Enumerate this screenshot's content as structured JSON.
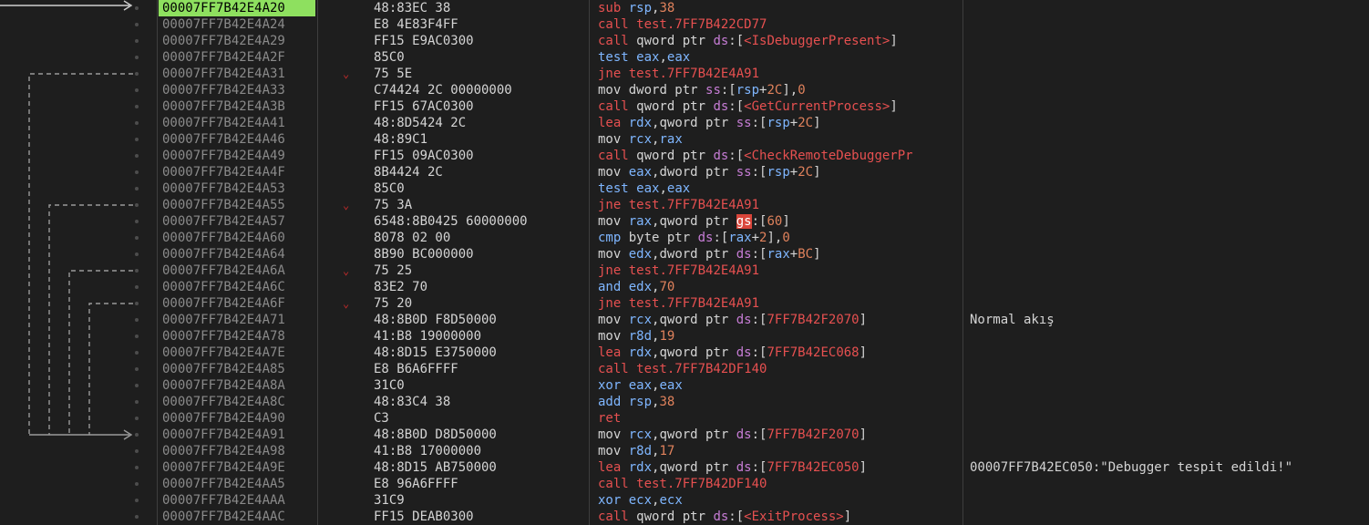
{
  "rows": [
    {
      "addr": "00007FF7B42E4A20",
      "bytes": "48:83EC 38",
      "instr": [
        {
          "t": "sub",
          "c": "mn"
        },
        {
          "t": " ",
          "c": "txt"
        },
        {
          "t": "rsp",
          "c": "reg"
        },
        {
          "t": ",",
          "c": "txt"
        },
        {
          "t": "38",
          "c": "num"
        }
      ],
      "selected": true
    },
    {
      "addr": "00007FF7B42E4A24",
      "bytes": "E8 4E83F4FF",
      "instr": [
        {
          "t": "call",
          "c": "mn"
        },
        {
          "t": " test.7FF7B422CD77",
          "c": "sym"
        }
      ]
    },
    {
      "addr": "00007FF7B42E4A29",
      "bytes": "FF15 E9AC0300",
      "instr": [
        {
          "t": "call",
          "c": "mn"
        },
        {
          "t": " qword ptr ",
          "c": "kw"
        },
        {
          "t": "ds",
          "c": "seg"
        },
        {
          "t": ":[",
          "c": "txt"
        },
        {
          "t": "<IsDebuggerPresent>",
          "c": "sym"
        },
        {
          "t": "]",
          "c": "txt"
        }
      ]
    },
    {
      "addr": "00007FF7B42E4A2F",
      "bytes": "85C0",
      "instr": [
        {
          "t": "test",
          "c": "reg"
        },
        {
          "t": " ",
          "c": "txt"
        },
        {
          "t": "eax",
          "c": "reg"
        },
        {
          "t": ",",
          "c": "txt"
        },
        {
          "t": "eax",
          "c": "reg"
        }
      ]
    },
    {
      "addr": "00007FF7B42E4A31",
      "bytes": "75 5E",
      "arrow": "⌄",
      "instr": [
        {
          "t": "jne",
          "c": "mn"
        },
        {
          "t": " test.7FF7B42E4A91",
          "c": "sym"
        }
      ]
    },
    {
      "addr": "00007FF7B42E4A33",
      "bytes": "C74424 2C 00000000",
      "instr": [
        {
          "t": "mov",
          "c": "txt"
        },
        {
          "t": " dword ptr ",
          "c": "kw"
        },
        {
          "t": "ss",
          "c": "seg"
        },
        {
          "t": ":[",
          "c": "txt"
        },
        {
          "t": "rsp",
          "c": "reg"
        },
        {
          "t": "+",
          "c": "txt"
        },
        {
          "t": "2C",
          "c": "num"
        },
        {
          "t": "],",
          "c": "txt"
        },
        {
          "t": "0",
          "c": "num"
        }
      ]
    },
    {
      "addr": "00007FF7B42E4A3B",
      "bytes": "FF15 67AC0300",
      "instr": [
        {
          "t": "call",
          "c": "mn"
        },
        {
          "t": " qword ptr ",
          "c": "kw"
        },
        {
          "t": "ds",
          "c": "seg"
        },
        {
          "t": ":[",
          "c": "txt"
        },
        {
          "t": "<GetCurrentProcess>",
          "c": "sym"
        },
        {
          "t": "]",
          "c": "txt"
        }
      ]
    },
    {
      "addr": "00007FF7B42E4A41",
      "bytes": "48:8D5424 2C",
      "instr": [
        {
          "t": "lea",
          "c": "mn"
        },
        {
          "t": " ",
          "c": "txt"
        },
        {
          "t": "rdx",
          "c": "reg"
        },
        {
          "t": ",qword ptr ",
          "c": "kw"
        },
        {
          "t": "ss",
          "c": "seg"
        },
        {
          "t": ":[",
          "c": "txt"
        },
        {
          "t": "rsp",
          "c": "reg"
        },
        {
          "t": "+",
          "c": "txt"
        },
        {
          "t": "2C",
          "c": "num"
        },
        {
          "t": "]",
          "c": "txt"
        }
      ]
    },
    {
      "addr": "00007FF7B42E4A46",
      "bytes": "48:89C1",
      "instr": [
        {
          "t": "mov",
          "c": "txt"
        },
        {
          "t": " ",
          "c": "txt"
        },
        {
          "t": "rcx",
          "c": "reg"
        },
        {
          "t": ",",
          "c": "txt"
        },
        {
          "t": "rax",
          "c": "reg"
        }
      ]
    },
    {
      "addr": "00007FF7B42E4A49",
      "bytes": "FF15 09AC0300",
      "instr": [
        {
          "t": "call",
          "c": "mn"
        },
        {
          "t": " qword ptr ",
          "c": "kw"
        },
        {
          "t": "ds",
          "c": "seg"
        },
        {
          "t": ":[",
          "c": "txt"
        },
        {
          "t": "<CheckRemoteDebuggerPr",
          "c": "sym"
        }
      ]
    },
    {
      "addr": "00007FF7B42E4A4F",
      "bytes": "8B4424 2C",
      "instr": [
        {
          "t": "mov",
          "c": "txt"
        },
        {
          "t": " ",
          "c": "txt"
        },
        {
          "t": "eax",
          "c": "reg"
        },
        {
          "t": ",dword ptr ",
          "c": "kw"
        },
        {
          "t": "ss",
          "c": "seg"
        },
        {
          "t": ":[",
          "c": "txt"
        },
        {
          "t": "rsp",
          "c": "reg"
        },
        {
          "t": "+",
          "c": "txt"
        },
        {
          "t": "2C",
          "c": "num"
        },
        {
          "t": "]",
          "c": "txt"
        }
      ]
    },
    {
      "addr": "00007FF7B42E4A53",
      "bytes": "85C0",
      "instr": [
        {
          "t": "test",
          "c": "reg"
        },
        {
          "t": " ",
          "c": "txt"
        },
        {
          "t": "eax",
          "c": "reg"
        },
        {
          "t": ",",
          "c": "txt"
        },
        {
          "t": "eax",
          "c": "reg"
        }
      ]
    },
    {
      "addr": "00007FF7B42E4A55",
      "bytes": "75 3A",
      "arrow": "⌄",
      "instr": [
        {
          "t": "jne",
          "c": "mn"
        },
        {
          "t": " test.7FF7B42E4A91",
          "c": "sym"
        }
      ]
    },
    {
      "addr": "00007FF7B42E4A57",
      "bytes": "6548:8B0425 60000000",
      "instr": [
        {
          "t": "mov",
          "c": "txt"
        },
        {
          "t": " ",
          "c": "txt"
        },
        {
          "t": "rax",
          "c": "reg"
        },
        {
          "t": ",qword ptr ",
          "c": "kw"
        },
        {
          "t": "gs",
          "c": "seghl"
        },
        {
          "t": ":[",
          "c": "txt"
        },
        {
          "t": "60",
          "c": "num"
        },
        {
          "t": "]",
          "c": "txt"
        }
      ]
    },
    {
      "addr": "00007FF7B42E4A60",
      "bytes": "8078 02 00",
      "instr": [
        {
          "t": "cmp",
          "c": "reg"
        },
        {
          "t": " byte ptr ",
          "c": "kw"
        },
        {
          "t": "ds",
          "c": "seg"
        },
        {
          "t": ":[",
          "c": "txt"
        },
        {
          "t": "rax",
          "c": "reg"
        },
        {
          "t": "+",
          "c": "txt"
        },
        {
          "t": "2",
          "c": "num"
        },
        {
          "t": "],",
          "c": "txt"
        },
        {
          "t": "0",
          "c": "num"
        }
      ]
    },
    {
      "addr": "00007FF7B42E4A64",
      "bytes": "8B90 BC000000",
      "instr": [
        {
          "t": "mov",
          "c": "txt"
        },
        {
          "t": " ",
          "c": "txt"
        },
        {
          "t": "edx",
          "c": "reg"
        },
        {
          "t": ",dword ptr ",
          "c": "kw"
        },
        {
          "t": "ds",
          "c": "seg"
        },
        {
          "t": ":[",
          "c": "txt"
        },
        {
          "t": "rax",
          "c": "reg"
        },
        {
          "t": "+",
          "c": "txt"
        },
        {
          "t": "BC",
          "c": "num"
        },
        {
          "t": "]",
          "c": "txt"
        }
      ]
    },
    {
      "addr": "00007FF7B42E4A6A",
      "bytes": "75 25",
      "arrow": "⌄",
      "instr": [
        {
          "t": "jne",
          "c": "mn"
        },
        {
          "t": " test.7FF7B42E4A91",
          "c": "sym"
        }
      ]
    },
    {
      "addr": "00007FF7B42E4A6C",
      "bytes": "83E2 70",
      "instr": [
        {
          "t": "and",
          "c": "reg"
        },
        {
          "t": " ",
          "c": "txt"
        },
        {
          "t": "edx",
          "c": "reg"
        },
        {
          "t": ",",
          "c": "txt"
        },
        {
          "t": "70",
          "c": "num"
        }
      ]
    },
    {
      "addr": "00007FF7B42E4A6F",
      "bytes": "75 20",
      "arrow": "⌄",
      "instr": [
        {
          "t": "jne",
          "c": "mn"
        },
        {
          "t": " test.7FF7B42E4A91",
          "c": "sym"
        }
      ]
    },
    {
      "addr": "00007FF7B42E4A71",
      "bytes": "48:8B0D F8D50000",
      "instr": [
        {
          "t": "mov",
          "c": "txt"
        },
        {
          "t": " ",
          "c": "txt"
        },
        {
          "t": "rcx",
          "c": "reg"
        },
        {
          "t": ",qword ptr ",
          "c": "kw"
        },
        {
          "t": "ds",
          "c": "seg"
        },
        {
          "t": ":[",
          "c": "txt"
        },
        {
          "t": "7FF7B42F2070",
          "c": "sym"
        },
        {
          "t": "]",
          "c": "txt"
        }
      ],
      "comment": "Normal akış"
    },
    {
      "addr": "00007FF7B42E4A78",
      "bytes": "41:B8 19000000",
      "instr": [
        {
          "t": "mov",
          "c": "txt"
        },
        {
          "t": " ",
          "c": "txt"
        },
        {
          "t": "r8d",
          "c": "reg"
        },
        {
          "t": ",",
          "c": "txt"
        },
        {
          "t": "19",
          "c": "num"
        }
      ]
    },
    {
      "addr": "00007FF7B42E4A7E",
      "bytes": "48:8D15 E3750000",
      "instr": [
        {
          "t": "lea",
          "c": "mn"
        },
        {
          "t": " ",
          "c": "txt"
        },
        {
          "t": "rdx",
          "c": "reg"
        },
        {
          "t": ",qword ptr ",
          "c": "kw"
        },
        {
          "t": "ds",
          "c": "seg"
        },
        {
          "t": ":[",
          "c": "txt"
        },
        {
          "t": "7FF7B42EC068",
          "c": "sym"
        },
        {
          "t": "]",
          "c": "txt"
        }
      ]
    },
    {
      "addr": "00007FF7B42E4A85",
      "bytes": "E8 B6A6FFFF",
      "instr": [
        {
          "t": "call",
          "c": "mn"
        },
        {
          "t": " test.7FF7B42DF140",
          "c": "sym"
        }
      ]
    },
    {
      "addr": "00007FF7B42E4A8A",
      "bytes": "31C0",
      "instr": [
        {
          "t": "xor",
          "c": "reg"
        },
        {
          "t": " ",
          "c": "txt"
        },
        {
          "t": "eax",
          "c": "reg"
        },
        {
          "t": ",",
          "c": "txt"
        },
        {
          "t": "eax",
          "c": "reg"
        }
      ]
    },
    {
      "addr": "00007FF7B42E4A8C",
      "bytes": "48:83C4 38",
      "instr": [
        {
          "t": "add",
          "c": "reg"
        },
        {
          "t": " ",
          "c": "txt"
        },
        {
          "t": "rsp",
          "c": "reg"
        },
        {
          "t": ",",
          "c": "txt"
        },
        {
          "t": "38",
          "c": "num"
        }
      ]
    },
    {
      "addr": "00007FF7B42E4A90",
      "bytes": "C3",
      "instr": [
        {
          "t": "ret",
          "c": "mn"
        }
      ]
    },
    {
      "addr": "00007FF7B42E4A91",
      "bytes": "48:8B0D D8D50000",
      "instr": [
        {
          "t": "mov",
          "c": "txt"
        },
        {
          "t": " ",
          "c": "txt"
        },
        {
          "t": "rcx",
          "c": "reg"
        },
        {
          "t": ",qword ptr ",
          "c": "kw"
        },
        {
          "t": "ds",
          "c": "seg"
        },
        {
          "t": ":[",
          "c": "txt"
        },
        {
          "t": "7FF7B42F2070",
          "c": "sym"
        },
        {
          "t": "]",
          "c": "txt"
        }
      ]
    },
    {
      "addr": "00007FF7B42E4A98",
      "bytes": "41:B8 17000000",
      "instr": [
        {
          "t": "mov",
          "c": "txt"
        },
        {
          "t": " ",
          "c": "txt"
        },
        {
          "t": "r8d",
          "c": "reg"
        },
        {
          "t": ",",
          "c": "txt"
        },
        {
          "t": "17",
          "c": "num"
        }
      ]
    },
    {
      "addr": "00007FF7B42E4A9E",
      "bytes": "48:8D15 AB750000",
      "instr": [
        {
          "t": "lea",
          "c": "mn"
        },
        {
          "t": " ",
          "c": "txt"
        },
        {
          "t": "rdx",
          "c": "reg"
        },
        {
          "t": ",qword ptr ",
          "c": "kw"
        },
        {
          "t": "ds",
          "c": "seg"
        },
        {
          "t": ":[",
          "c": "txt"
        },
        {
          "t": "7FF7B42EC050",
          "c": "sym"
        },
        {
          "t": "]",
          "c": "txt"
        }
      ],
      "comment": "00007FF7B42EC050:\"Debugger tespit edildi!\""
    },
    {
      "addr": "00007FF7B42E4AA5",
      "bytes": "E8 96A6FFFF",
      "instr": [
        {
          "t": "call",
          "c": "mn"
        },
        {
          "t": " test.7FF7B42DF140",
          "c": "sym"
        }
      ]
    },
    {
      "addr": "00007FF7B42E4AAA",
      "bytes": "31C9",
      "instr": [
        {
          "t": "xor",
          "c": "reg"
        },
        {
          "t": " ",
          "c": "txt"
        },
        {
          "t": "ecx",
          "c": "reg"
        },
        {
          "t": ",",
          "c": "txt"
        },
        {
          "t": "ecx",
          "c": "reg"
        }
      ]
    },
    {
      "addr": "00007FF7B42E4AAC",
      "bytes": "FF15 DEAB0300",
      "instr": [
        {
          "t": "call",
          "c": "mn"
        },
        {
          "t": " qword ptr ",
          "c": "kw"
        },
        {
          "t": "ds",
          "c": "seg"
        },
        {
          "t": ":[",
          "c": "txt"
        },
        {
          "t": "<ExitProcess>",
          "c": "sym"
        },
        {
          "t": "]",
          "c": "txt"
        }
      ]
    }
  ],
  "colors": {
    "background": "#1e1e1e",
    "selected_row": "#8ee05f",
    "mnemonic_red": "#e65050",
    "register_blue": "#7fb6ff",
    "number_orange": "#e0825c",
    "segment_purple": "#c77dd6"
  },
  "icons": {
    "jump_arrow": "chevron-down-icon",
    "branch_line": "dashed-branch-line",
    "current_ip": "arrow-right-icon"
  }
}
